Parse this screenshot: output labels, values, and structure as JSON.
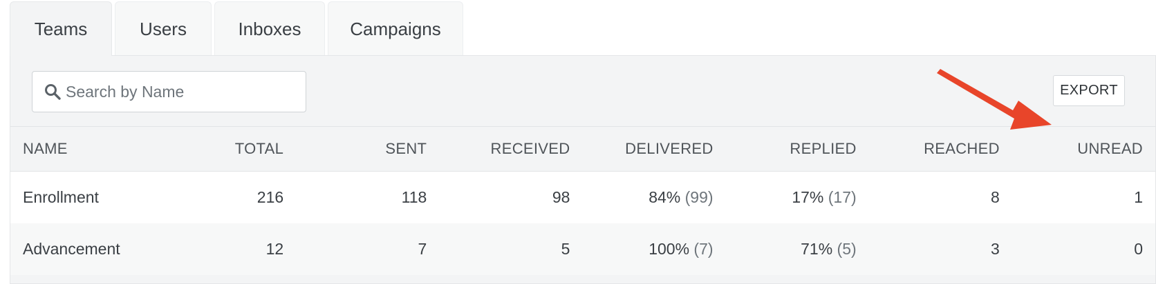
{
  "tabs": [
    {
      "label": "Teams",
      "active": true
    },
    {
      "label": "Users",
      "active": false
    },
    {
      "label": "Inboxes",
      "active": false
    },
    {
      "label": "Campaigns",
      "active": false
    }
  ],
  "search": {
    "placeholder": "Search by Name",
    "icon": "magnifier"
  },
  "export": {
    "label": "EXPORT"
  },
  "annotation": {
    "arrow_color": "#e8452a"
  },
  "table": {
    "columns": [
      "NAME",
      "TOTAL",
      "SENT",
      "RECEIVED",
      "DELIVERED",
      "REPLIED",
      "REACHED",
      "UNREAD"
    ],
    "rows": [
      {
        "name": "Enrollment",
        "total": "216",
        "sent": "118",
        "received": "98",
        "delivered_pct": "84%",
        "delivered_count": "(99)",
        "replied_pct": "17%",
        "replied_count": "(17)",
        "reached": "8",
        "unread": "1"
      },
      {
        "name": "Advancement",
        "total": "12",
        "sent": "7",
        "received": "5",
        "delivered_pct": "100%",
        "delivered_count": "(7)",
        "replied_pct": "71%",
        "replied_count": "(5)",
        "reached": "3",
        "unread": "0"
      }
    ]
  }
}
